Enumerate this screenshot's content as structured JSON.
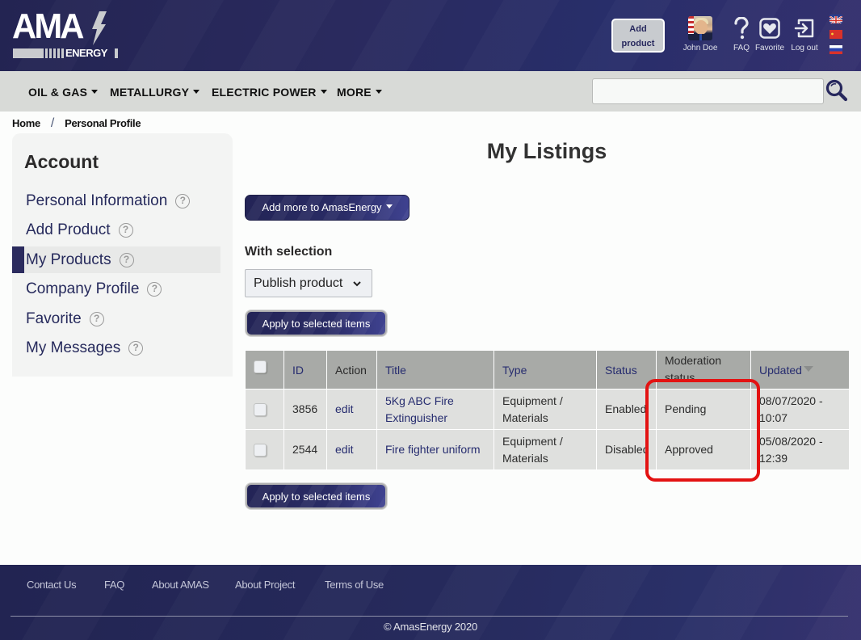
{
  "header": {
    "logo": {
      "main": "AMA",
      "sub": "ENERGY"
    },
    "add_product_label": [
      "Add",
      "product"
    ],
    "user": {
      "name": "John Doe",
      "avatar": "user-avatar-photo"
    },
    "icons": [
      {
        "name": "faq-icon",
        "label": "FAQ"
      },
      {
        "name": "favorite-icon",
        "label": "Favorite"
      },
      {
        "name": "logout-icon",
        "label": "Log out"
      }
    ],
    "languages": [
      "uk-flag",
      "china-flag",
      "russia-flag"
    ]
  },
  "nav": {
    "items": [
      {
        "label": "OIL & GAS"
      },
      {
        "label": "METALLURGY"
      },
      {
        "label": "ELECTRIC POWER"
      },
      {
        "label": "MORE"
      }
    ],
    "search": {
      "value": "",
      "placeholder": ""
    }
  },
  "breadcrumb": {
    "home": "Home",
    "separator": "/",
    "current": "Personal Profile"
  },
  "sidebar": {
    "title": "Account",
    "help_glyph": "?",
    "items": [
      {
        "label": "Personal Information",
        "active": false
      },
      {
        "label": "Add Product",
        "active": false
      },
      {
        "label": "My Products",
        "active": true
      },
      {
        "label": "Company Profile",
        "active": false
      },
      {
        "label": "Favorite",
        "active": false
      },
      {
        "label": "My Messages",
        "active": false
      }
    ]
  },
  "main": {
    "title": "My Listings",
    "add_more_label": "Add more to AmasEnergy",
    "with_selection_label": "With selection",
    "selection_action": {
      "selected": "Publish product"
    },
    "apply_label": "Apply to selected items",
    "table": {
      "columns": [
        "",
        "ID",
        "Action",
        "Title",
        "Type",
        "Status",
        "Moderation status",
        "Updated"
      ],
      "sort_column": "Updated",
      "rows": [
        {
          "checked": false,
          "id": "3856",
          "action": "edit",
          "title": "5Kg ABC Fire Extinguisher",
          "type": "Equipment / Materials",
          "status": "Enabled",
          "moderation": "Pending",
          "updated": "08/07/2020 - 10:07"
        },
        {
          "checked": false,
          "id": "2544",
          "action": "edit",
          "title": "Fire fighter uniform",
          "type": "Equipment / Materials",
          "status": "Disabled",
          "moderation": "Approved",
          "updated": "05/08/2020 - 12:39"
        }
      ]
    }
  },
  "footer": {
    "links": [
      "Contact Us",
      "FAQ",
      "About AMAS",
      "About Project",
      "Terms of Use"
    ],
    "copyright": "© AmasEnergy 2020"
  },
  "colors": {
    "brand_dark": "#27285d",
    "nav_bg": "#d8dad7",
    "highlight": "#e31212",
    "table_header": "#a8aaa7",
    "table_row": "#dfe0de"
  }
}
